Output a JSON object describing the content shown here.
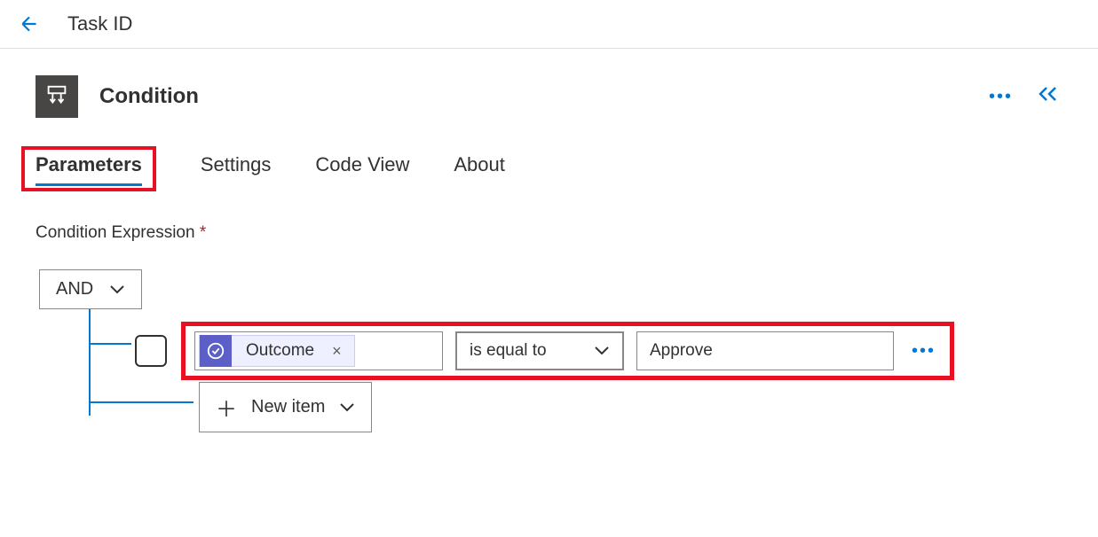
{
  "header": {
    "title": "Task ID"
  },
  "card": {
    "title": "Condition"
  },
  "tabs": {
    "parameters": "Parameters",
    "settings": "Settings",
    "code_view": "Code View",
    "about": "About",
    "active": "parameters"
  },
  "section": {
    "label": "Condition Expression",
    "required": "*"
  },
  "condition": {
    "logic_operator": "AND",
    "rows": [
      {
        "token": "Outcome",
        "operator": "is equal to",
        "value": "Approve"
      }
    ],
    "new_item_label": "New item"
  }
}
